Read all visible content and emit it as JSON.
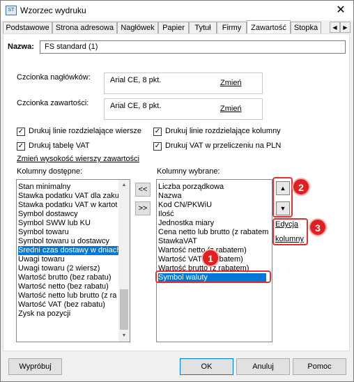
{
  "window": {
    "title": "Wzorzec wydruku",
    "close_label": "✕",
    "icon_label": "ST"
  },
  "tabs": [
    {
      "label": "Podstawowe"
    },
    {
      "label": "Strona adresowa"
    },
    {
      "label": "Nagłówek"
    },
    {
      "label": "Papier"
    },
    {
      "label": "Tytuł"
    },
    {
      "label": "Firmy"
    },
    {
      "label": "Zawartość"
    },
    {
      "label": "Stopka"
    }
  ],
  "tab_scroll": {
    "left": "◀",
    "right": "▶"
  },
  "name_field": {
    "label": "Nazwa:",
    "value": "FS standard (1)"
  },
  "header_font": {
    "label": "Czcionka nagłówków:",
    "value": "Arial CE, 8 pkt.",
    "change_link": "Zmień"
  },
  "content_font": {
    "label": "Czcionka zawartości:",
    "value": "Arial CE, 8 pkt.",
    "change_link": "Zmień"
  },
  "checkboxes": [
    {
      "label": "Drukuj linie rozdzielające wiersze",
      "checked": true
    },
    {
      "label": "Drukuj linie rozdzielające kolumny",
      "checked": true
    },
    {
      "label": "Drukuj tabelę VAT",
      "checked": true
    },
    {
      "label": "Drukuj VAT w przeliczeniu na PLN",
      "checked": true
    }
  ],
  "row_height_link": "Zmień wysokość wierszy zawartości",
  "available": {
    "label": "Kolumny dostępne:",
    "items": [
      "Stan minimalny",
      "Stawka podatku VAT dla zakup",
      "Stawka podatku VAT w kartot",
      "Symbol dostawcy",
      "Symbol SWW lub KU",
      "Symbol towaru",
      "Symbol towaru u dostawcy",
      "Średni czas dostawy w dniach",
      "Uwagi towaru",
      "Uwagi towaru (2 wiersz)",
      "Wartość brutto (bez rabatu)",
      "Wartość netto (bez rabatu)",
      "Wartość netto lub brutto (z ra",
      "Wartość VAT (bez rabatu)",
      "Zysk na pozycji"
    ],
    "selected_index": 7
  },
  "move_buttons": {
    "left": "<<",
    "right": ">>"
  },
  "chosen": {
    "label": "Kolumny wybrane:",
    "items": [
      "Liczba porządkowa",
      "Nazwa",
      "Kod CN/PKWiU",
      "Ilość",
      "Jednostka miary",
      "Cena netto lub brutto (z rabatem",
      "StawkaVAT",
      "Wartość netto (z rabatem)",
      "Wartość VAT (z rabatem)",
      "Wartość brutto (z rabatem)",
      "Symbol waluty"
    ],
    "selected_index": 10
  },
  "order_buttons": {
    "up": "▲",
    "down": "▼"
  },
  "edit_link": {
    "line1": "Edycja",
    "line2": "kolumny"
  },
  "badges": {
    "one": "1",
    "two": "2",
    "three": "3"
  },
  "buttons": {
    "test": "Wypróbuj",
    "ok": "OK",
    "cancel": "Anuluj",
    "help": "Pomoc"
  }
}
